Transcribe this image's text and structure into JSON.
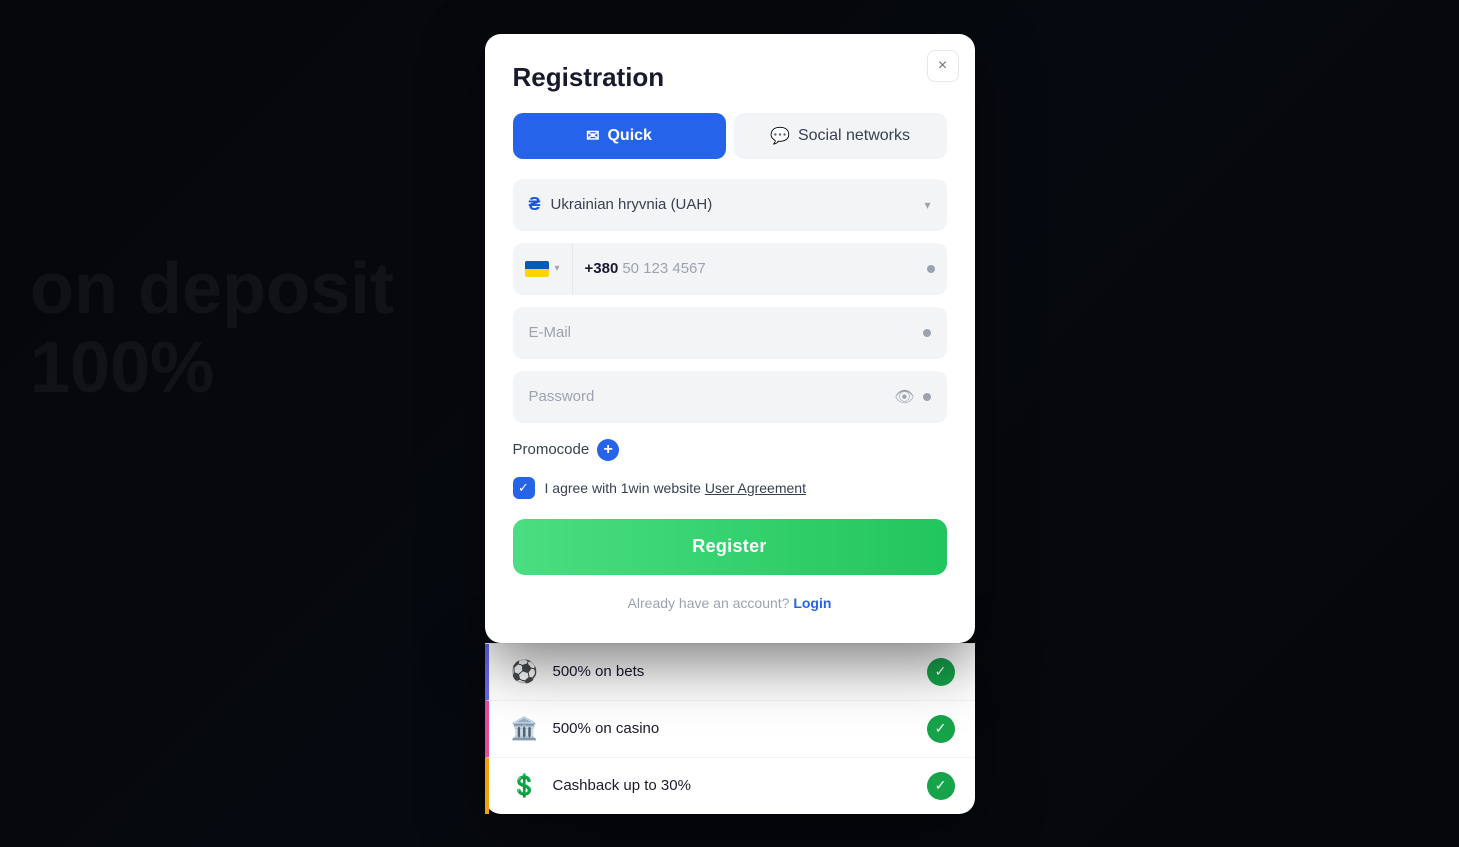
{
  "modal": {
    "title": "Registration",
    "close_label": "×",
    "tabs": {
      "quick_label": "Quick",
      "social_label": "Social networks"
    },
    "currency": {
      "value": "Ukrainian hryvnia (UAH)",
      "icon": "₴"
    },
    "phone": {
      "country_code": "+380",
      "placeholder": "50 123 4567",
      "flag_country": "UA"
    },
    "email_placeholder": "E-Mail",
    "password_placeholder": "Password",
    "promocode_label": "Promocode",
    "agree_text": "I agree with 1win website",
    "agree_link": "User Agreement",
    "register_label": "Register",
    "login_prompt": "Already have an account?",
    "login_label": "Login"
  },
  "bonuses": [
    {
      "icon": "⚽",
      "text": "500% on bets",
      "stripe_color": "#6366f1"
    },
    {
      "icon": "🏛️",
      "text": "500% on casino",
      "stripe_color": "#ec4899"
    },
    {
      "icon": "💲",
      "text": "Cashback up to 30%",
      "stripe_color": "#f59e0b"
    }
  ],
  "background": {
    "text_line1": "on deposit",
    "text_line2": "100%"
  }
}
